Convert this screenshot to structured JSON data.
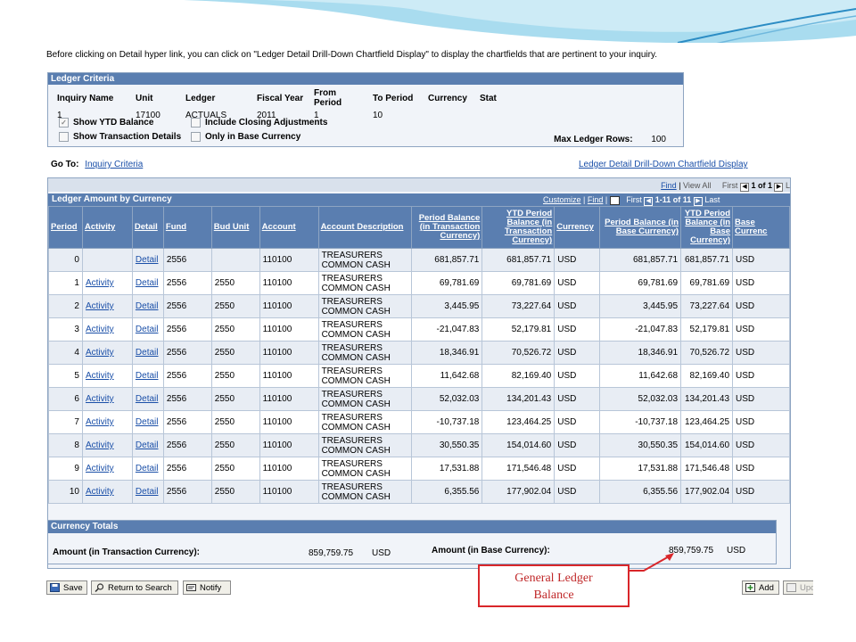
{
  "intro": "Before clicking on Detail hyper link, you can click on \"Ledger Detail Drill-Down Chartfield Display\" to display the chartfields that are pertinent to your inquiry.",
  "criteria": {
    "title": "Ledger Criteria",
    "headers": [
      "Inquiry Name",
      "Unit",
      "Ledger",
      "Fiscal Year",
      "From Period",
      "To Period",
      "Currency",
      "Stat"
    ],
    "values": [
      "1",
      "17100",
      "ACTUALS",
      "2011",
      "1",
      "10",
      "",
      ""
    ],
    "show_ytd": "Show YTD Balance",
    "include_closing": "Include Closing Adjustments",
    "show_transaction": "Show Transaction Details",
    "only_base": "Only in Base Currency",
    "max_rows_label": "Max Ledger Rows:",
    "max_rows_value": "100"
  },
  "goto": {
    "label": "Go To:",
    "inquiry_link": "Inquiry Criteria",
    "drill_link": "Ledger Detail Drill-Down Chartfield Display"
  },
  "outer_nav": {
    "find": "Find",
    "view_all": "View All",
    "first": "First",
    "range": "1 of 1",
    "last": "L"
  },
  "grid": {
    "title": "Ledger Amount by Currency",
    "customize": "Customize",
    "find": "Find",
    "first": "First",
    "range": "1-11 of 11",
    "last": "Last",
    "columns": [
      "Period",
      "Activity",
      "Detail",
      "Fund",
      "Bud Unit",
      "Account",
      "Account Description",
      "Period Balance (in Transaction Currency)",
      "YTD Period Balance (in Transaction Currency)",
      "Currency",
      "Period Balance (in Base Currency)",
      "YTD Period Balance (in Base Currency)",
      "Base Currenc"
    ],
    "rows": [
      [
        "0",
        "",
        "Detail",
        "2556",
        "",
        "110100",
        "TREASURERS COMMON CASH",
        "681,857.71",
        "681,857.71",
        "USD",
        "681,857.71",
        "681,857.71",
        "USD"
      ],
      [
        "1",
        "Activity",
        "Detail",
        "2556",
        "2550",
        "110100",
        "TREASURERS COMMON CASH",
        "69,781.69",
        "69,781.69",
        "USD",
        "69,781.69",
        "69,781.69",
        "USD"
      ],
      [
        "2",
        "Activity",
        "Detail",
        "2556",
        "2550",
        "110100",
        "TREASURERS COMMON CASH",
        "3,445.95",
        "73,227.64",
        "USD",
        "3,445.95",
        "73,227.64",
        "USD"
      ],
      [
        "3",
        "Activity",
        "Detail",
        "2556",
        "2550",
        "110100",
        "TREASURERS COMMON CASH",
        "-21,047.83",
        "52,179.81",
        "USD",
        "-21,047.83",
        "52,179.81",
        "USD"
      ],
      [
        "4",
        "Activity",
        "Detail",
        "2556",
        "2550",
        "110100",
        "TREASURERS COMMON CASH",
        "18,346.91",
        "70,526.72",
        "USD",
        "18,346.91",
        "70,526.72",
        "USD"
      ],
      [
        "5",
        "Activity",
        "Detail",
        "2556",
        "2550",
        "110100",
        "TREASURERS COMMON CASH",
        "11,642.68",
        "82,169.40",
        "USD",
        "11,642.68",
        "82,169.40",
        "USD"
      ],
      [
        "6",
        "Activity",
        "Detail",
        "2556",
        "2550",
        "110100",
        "TREASURERS COMMON CASH",
        "52,032.03",
        "134,201.43",
        "USD",
        "52,032.03",
        "134,201.43",
        "USD"
      ],
      [
        "7",
        "Activity",
        "Detail",
        "2556",
        "2550",
        "110100",
        "TREASURERS COMMON CASH",
        "-10,737.18",
        "123,464.25",
        "USD",
        "-10,737.18",
        "123,464.25",
        "USD"
      ],
      [
        "8",
        "Activity",
        "Detail",
        "2556",
        "2550",
        "110100",
        "TREASURERS COMMON CASH",
        "30,550.35",
        "154,014.60",
        "USD",
        "30,550.35",
        "154,014.60",
        "USD"
      ],
      [
        "9",
        "Activity",
        "Detail",
        "2556",
        "2550",
        "110100",
        "TREASURERS COMMON CASH",
        "17,531.88",
        "171,546.48",
        "USD",
        "17,531.88",
        "171,546.48",
        "USD"
      ],
      [
        "10",
        "Activity",
        "Detail",
        "2556",
        "2550",
        "110100",
        "TREASURERS COMMON CASH",
        "6,355.56",
        "177,902.04",
        "USD",
        "6,355.56",
        "177,902.04",
        "USD"
      ]
    ]
  },
  "totals": {
    "title": "Currency Totals",
    "transaction_label": "Amount (in Transaction Currency):",
    "transaction_value": "859,759.75",
    "transaction_currency": "USD",
    "base_label": "Amount (in Base Currency):",
    "base_value": "859,759.75",
    "base_currency": "USD"
  },
  "buttons": {
    "save": "Save",
    "return": "Return to Search",
    "notify": "Notify",
    "add": "Add",
    "update": "Upd"
  },
  "callout": {
    "line1": "General Ledger",
    "line2": "Balance"
  },
  "colors": {
    "header_blue": "#5a7eb0",
    "link_blue": "#1a4fa8",
    "callout_red": "#d9262a"
  }
}
